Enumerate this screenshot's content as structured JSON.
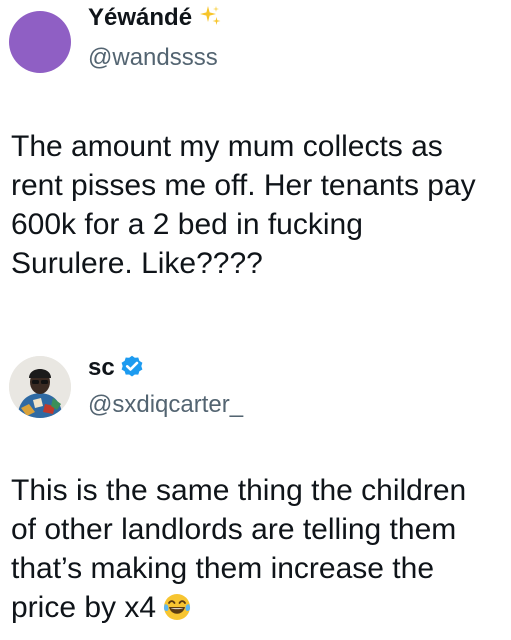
{
  "original_tweet": {
    "display_name": "Yéwándé",
    "name_emoji_icon": "sparkles-icon",
    "handle": "@wandssss",
    "avatar_color": "#8f5fc4",
    "text_lines": [
      "The amount my mum collects as",
      "rent pisses me off. Her tenants pay",
      "600k for a 2 bed in fucking",
      "Surulere. Like????"
    ]
  },
  "reply_tweet": {
    "display_name": "sc",
    "verified_icon": "verified-badge-icon",
    "verified_color": "#1d9bf0",
    "handle": "@sxdiqcarter_",
    "text_lines": [
      "This is the same thing the children",
      "of other landlords are telling them",
      "that’s making them increase the",
      "price by x4"
    ],
    "trailing_emoji_icon": "tears-of-joy-emoji-icon"
  }
}
